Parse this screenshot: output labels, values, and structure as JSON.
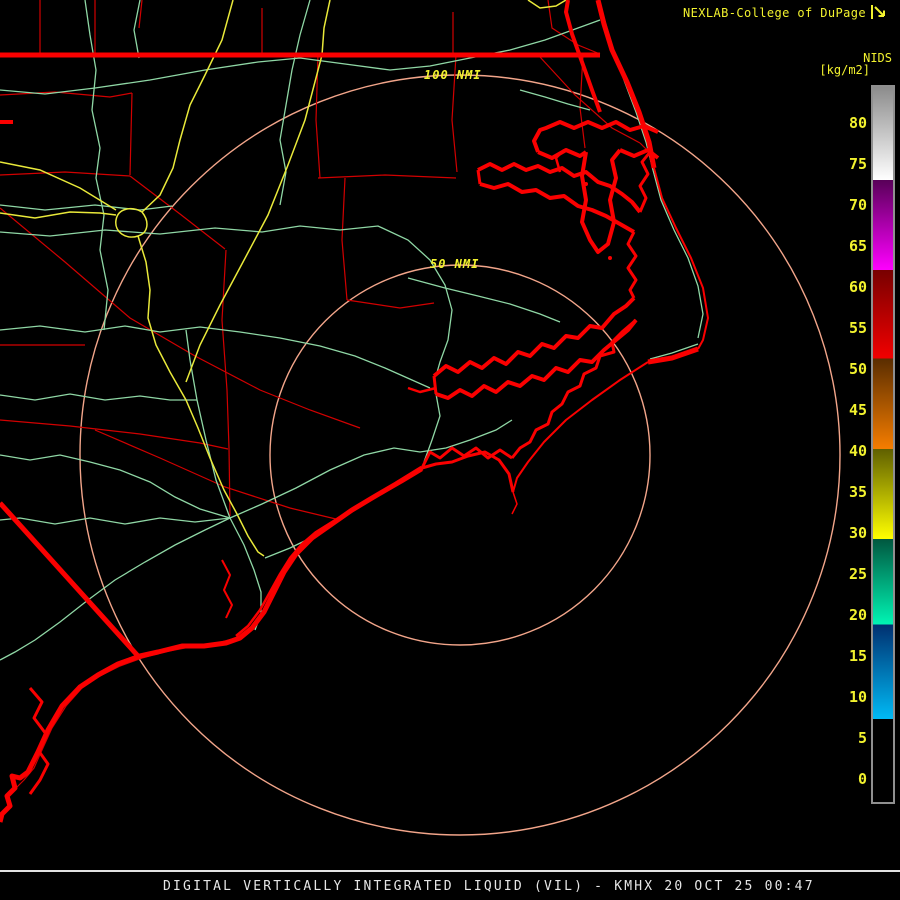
{
  "header": {
    "title": "NEXLAB-College of DuPage",
    "logo_icon": "corner-arrow-logo"
  },
  "colorbar": {
    "product_label": "NIDS",
    "units_label": "[kg/m2]",
    "ticks": [
      "80",
      "75",
      "70",
      "65",
      "60",
      "55",
      "50",
      "45",
      "40",
      "35",
      "30",
      "25",
      "20",
      "15",
      "10",
      "5",
      "0"
    ],
    "segments": [
      {
        "value_range": "73-85",
        "colors": [
          "#8c8c8c",
          "#ffffff"
        ]
      },
      {
        "value_range": "62-73",
        "colors": [
          "#580058",
          "#ff00ff"
        ]
      },
      {
        "value_range": "51-62",
        "colors": [
          "#780000",
          "#f20000"
        ]
      },
      {
        "value_range": "41-51",
        "colors": [
          "#5a2d00",
          "#f57d00"
        ]
      },
      {
        "value_range": "30-41",
        "colors": [
          "#5f5f00",
          "#ffff00"
        ]
      },
      {
        "value_range": "19-30",
        "colors": [
          "#00573f",
          "#00f5b4"
        ]
      },
      {
        "value_range": "8-19",
        "colors": [
          "#003070",
          "#00baf5"
        ]
      },
      {
        "value_range": "0-8",
        "colors": [
          "#000000",
          "#000000"
        ]
      }
    ]
  },
  "map": {
    "range_rings": {
      "outer_label": "100 NMI",
      "inner_label": "50 NMI"
    },
    "colors": {
      "county_lines": "#d20000",
      "coastline": "#fa0000",
      "roads": "#8fd7a5",
      "highways": "#e9e93a",
      "range_rings": "#f2a58a",
      "label_yellow": "#f2f22e"
    }
  },
  "footer": {
    "caption": "DIGITAL VERTICALLY INTEGRATED LIQUID (VIL) - KMHX 20 OCT 25 00:47"
  }
}
